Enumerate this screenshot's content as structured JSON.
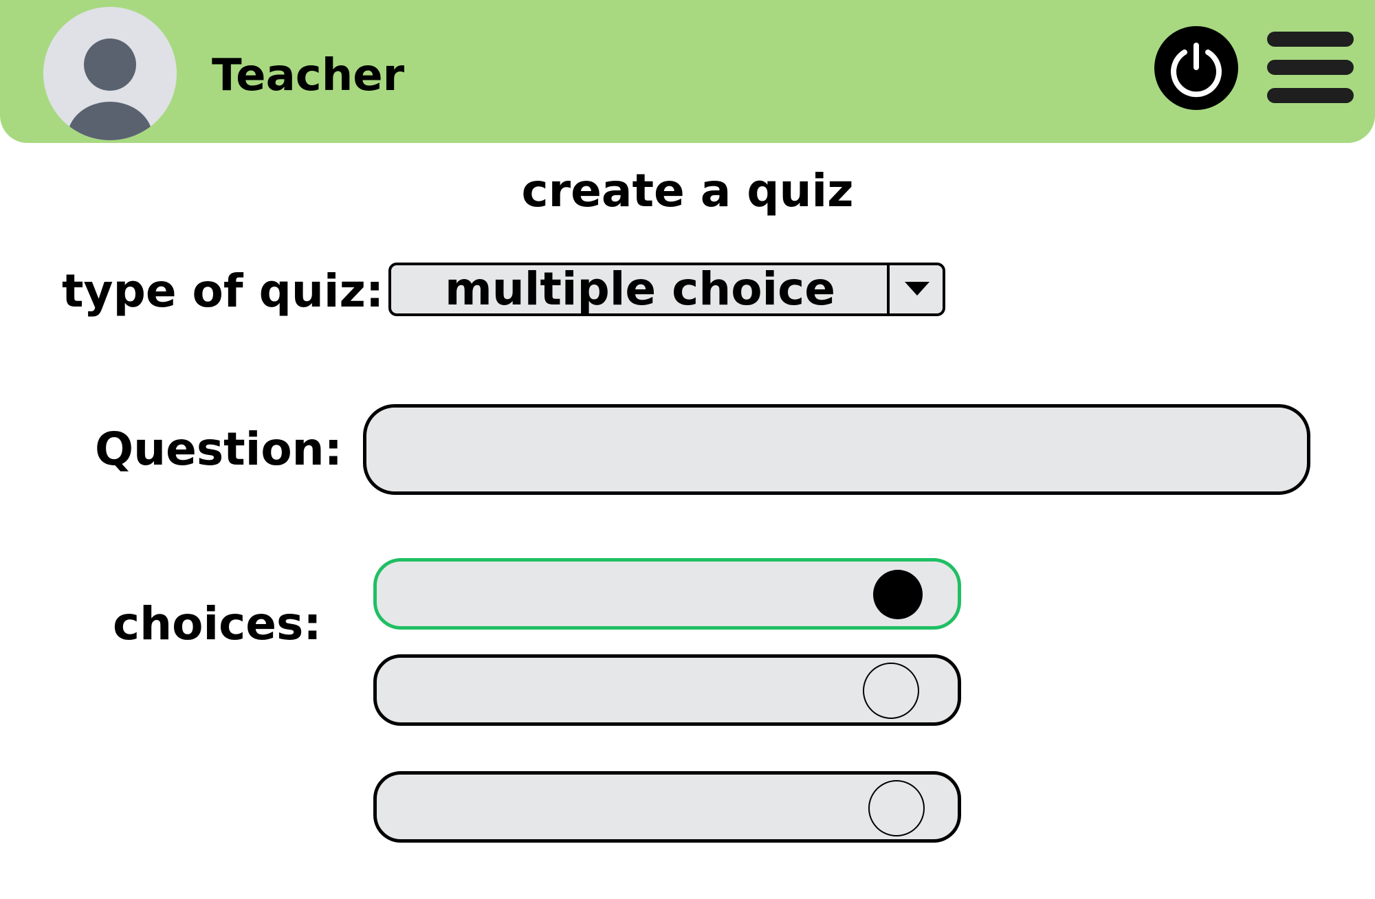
{
  "header": {
    "user_role": "Teacher",
    "background_color": "#a8d981",
    "avatar_icon": "user-avatar-icon",
    "power_icon": "power-icon",
    "menu_icon": "hamburger-menu-icon"
  },
  "page": {
    "title": "create a quiz"
  },
  "form": {
    "type_label": "type of quiz:",
    "type_selected": "multiple choice",
    "question_label": "Question:",
    "question_value": "",
    "choices_label": "choices:",
    "choices": [
      {
        "value": "",
        "selected": true
      },
      {
        "value": "",
        "selected": false
      },
      {
        "value": "",
        "selected": false
      }
    ],
    "selected_choice_color": "#1fbf63"
  }
}
